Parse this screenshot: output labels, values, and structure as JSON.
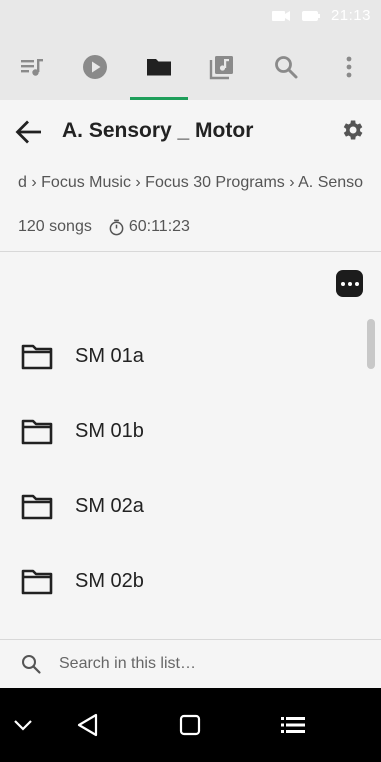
{
  "status_bar": {
    "time": "21:13",
    "icons": [
      "video-call-icon",
      "battery-icon"
    ]
  },
  "tabs": [
    {
      "name": "playlists",
      "icon": "queue-music-icon",
      "active": false
    },
    {
      "name": "now-playing",
      "icon": "play-circle-icon",
      "active": false
    },
    {
      "name": "folders",
      "icon": "folder-icon",
      "active": true
    },
    {
      "name": "library",
      "icon": "library-music-icon",
      "active": false
    },
    {
      "name": "search",
      "icon": "search-icon",
      "active": false
    },
    {
      "name": "overflow",
      "icon": "more-vert-icon",
      "active": false
    }
  ],
  "header": {
    "title": "A. Sensory _ Motor"
  },
  "breadcrumb": {
    "items": [
      "d",
      "Focus Music",
      "Focus 30 Programs",
      "A. Senso"
    ]
  },
  "meta": {
    "song_count": "120 songs",
    "duration": "60:11:23"
  },
  "folders": [
    {
      "label": "SM 01a"
    },
    {
      "label": "SM 01b"
    },
    {
      "label": "SM 02a"
    },
    {
      "label": "SM 02b"
    }
  ],
  "search": {
    "placeholder": "Search in this list…"
  },
  "colors": {
    "accent": "#1e9e5a",
    "tab_bar_bg": "#e8e8e8",
    "page_bg": "#f5f5f5",
    "icon_gray": "#8a8a8a"
  }
}
